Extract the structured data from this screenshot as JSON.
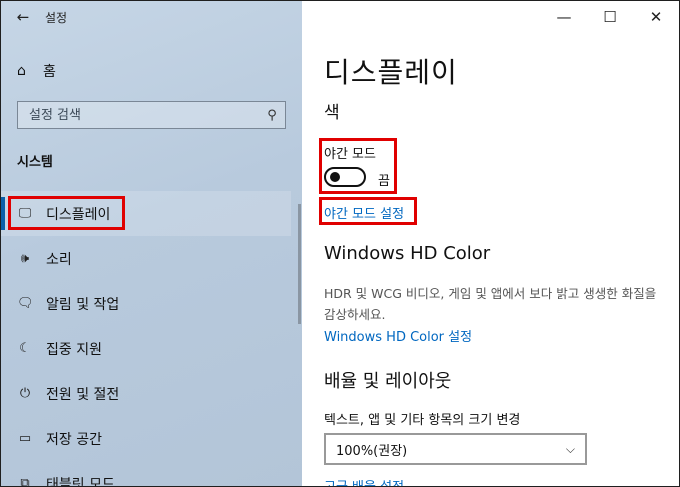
{
  "window": {
    "title": "설정",
    "back_icon": "←",
    "controls": {
      "minimize": "—",
      "maximize": "☐",
      "close": "✕"
    }
  },
  "sidebar": {
    "home": {
      "icon": "⌂",
      "label": "홈"
    },
    "search": {
      "placeholder": "설정 검색",
      "icon": "⚲"
    },
    "section_title": "시스템",
    "items": [
      {
        "icon": "🖵",
        "icon_name": "monitor-icon",
        "label": "디스플레이",
        "selected": true
      },
      {
        "icon": "🕪",
        "icon_name": "speaker-icon",
        "label": "소리"
      },
      {
        "icon": "🗨",
        "icon_name": "notification-icon",
        "label": "알림 및 작업"
      },
      {
        "icon": "☾",
        "icon_name": "moon-icon",
        "label": "집중 지원"
      },
      {
        "icon": "⏻",
        "icon_name": "power-icon",
        "label": "전원 및 절전"
      },
      {
        "icon": "▭",
        "icon_name": "storage-icon",
        "label": "저장 공간"
      },
      {
        "icon": "⧉",
        "icon_name": "tablet-icon",
        "label": "태블릿 모드"
      }
    ]
  },
  "main": {
    "page_title": "디스플레이",
    "color_section": "색",
    "night_light": {
      "label": "야간 모드",
      "state": "끔",
      "on": false
    },
    "night_light_settings_link": "야간 모드 설정",
    "hd_color": {
      "title": "Windows HD Color",
      "description": "HDR 및 WCG 비디오, 게임 및 앱에서 보다 밝고 생생한 화질을 감상하세요.",
      "link": "Windows HD Color 설정"
    },
    "layout": {
      "title": "배율 및 레이아웃",
      "scale_label": "텍스트, 앱 및 기타 항목의 크기 변경",
      "scale_value": "100%(권장)",
      "advanced_link": "고급 배율 설정"
    }
  },
  "colors": {
    "accent": "#0067c0",
    "highlight": "#e00000",
    "selected_bar": "#0a5fa8"
  }
}
